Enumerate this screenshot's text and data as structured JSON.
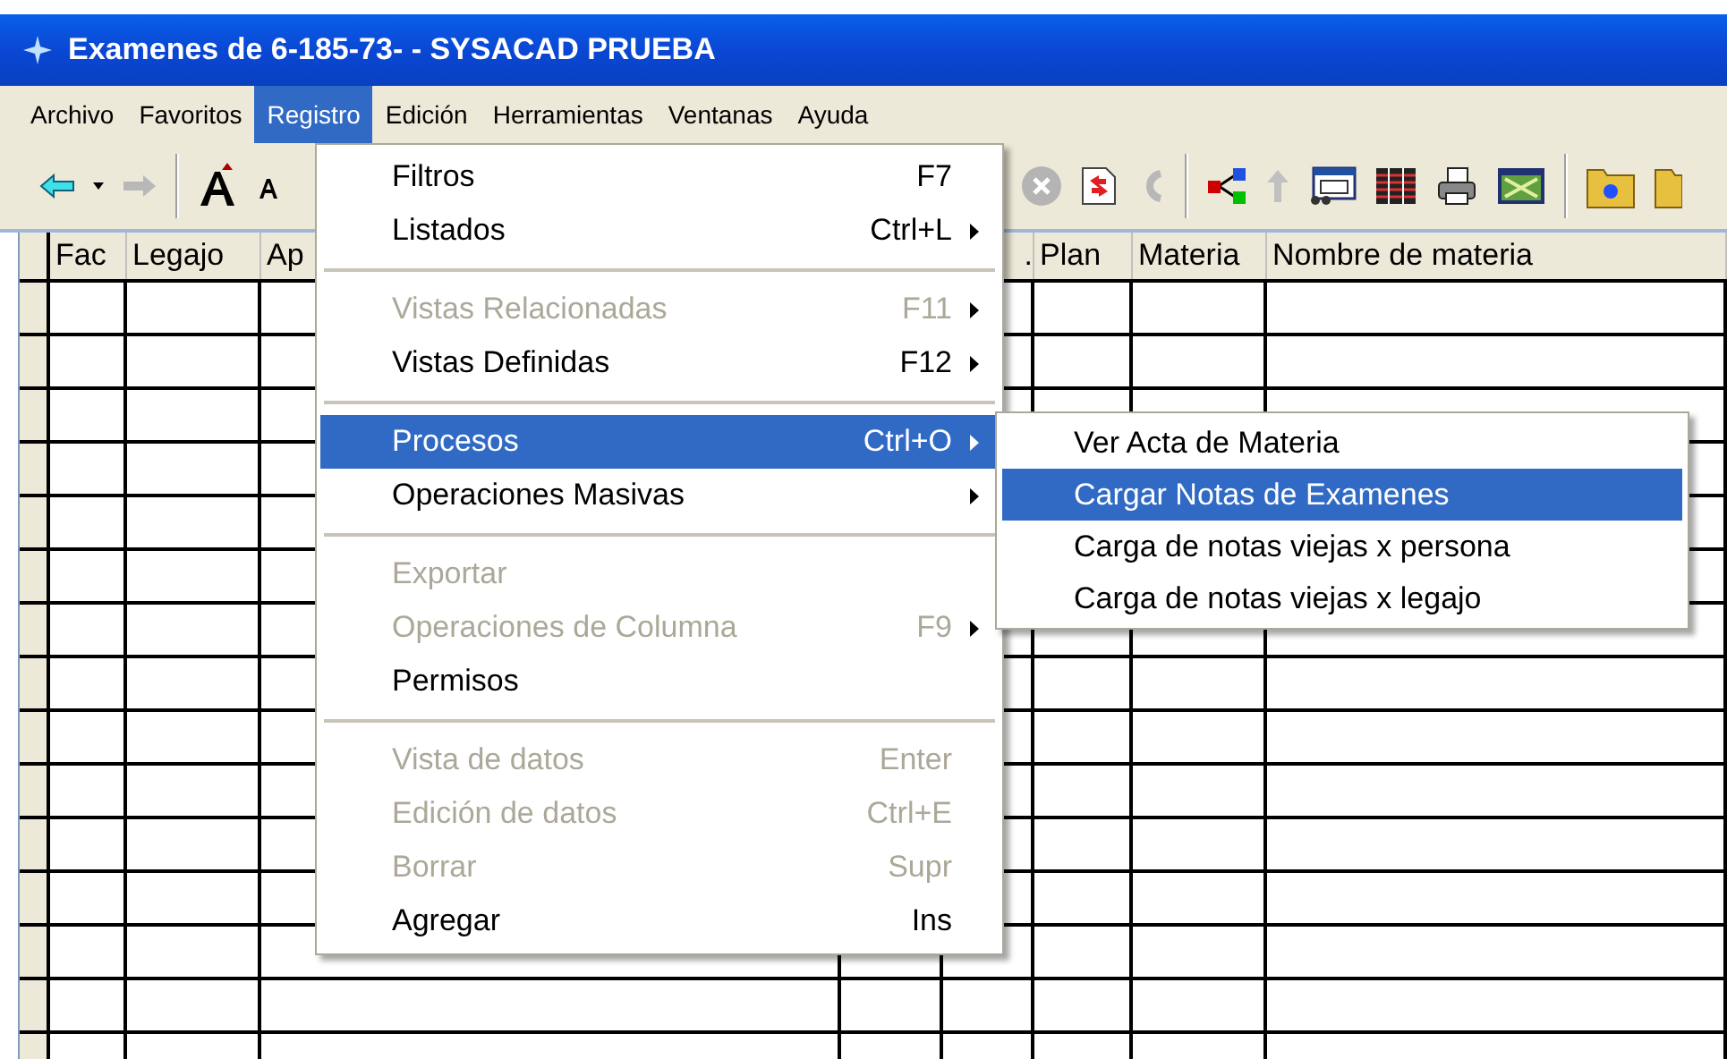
{
  "window": {
    "title": "Examenes de 6-185-73- - SYSACAD PRUEBA"
  },
  "menu_bar": [
    {
      "label": "Archivo",
      "selected": false
    },
    {
      "label": "Favoritos",
      "selected": false
    },
    {
      "label": "Registro",
      "selected": true
    },
    {
      "label": "Edición",
      "selected": false
    },
    {
      "label": "Herramientas",
      "selected": false
    },
    {
      "label": "Ventanas",
      "selected": false
    },
    {
      "label": "Ayuda",
      "selected": false
    }
  ],
  "grid": {
    "columns": [
      {
        "label": "Fac"
      },
      {
        "label": "Legajo"
      },
      {
        "label": "Ap"
      },
      {},
      {
        "label": "."
      },
      {
        "label": "Plan"
      },
      {
        "label": "Materia"
      },
      {
        "label": "Nombre de materia"
      }
    ]
  },
  "menu": {
    "items": [
      {
        "kind": "item",
        "label": "Filtros",
        "shortcut": "F7",
        "submenu": false,
        "disabled": false,
        "selected": false
      },
      {
        "kind": "item",
        "label": "Listados",
        "shortcut": "Ctrl+L",
        "submenu": true,
        "disabled": false,
        "selected": false
      },
      {
        "kind": "separator"
      },
      {
        "kind": "item",
        "label": "Vistas Relacionadas",
        "shortcut": "F11",
        "submenu": true,
        "disabled": true,
        "selected": false
      },
      {
        "kind": "item",
        "label": "Vistas Definidas",
        "shortcut": "F12",
        "submenu": true,
        "disabled": false,
        "selected": false
      },
      {
        "kind": "separator"
      },
      {
        "kind": "item",
        "label": "Procesos",
        "shortcut": "Ctrl+O",
        "submenu": true,
        "disabled": false,
        "selected": true
      },
      {
        "kind": "item",
        "label": "Operaciones Masivas",
        "submenu": true,
        "disabled": false,
        "selected": false
      },
      {
        "kind": "separator"
      },
      {
        "kind": "item",
        "label": "Exportar",
        "submenu": false,
        "disabled": true,
        "selected": false
      },
      {
        "kind": "item",
        "label": "Operaciones de Columna",
        "shortcut": "F9",
        "submenu": true,
        "disabled": true,
        "selected": false
      },
      {
        "kind": "item",
        "label": "Permisos",
        "submenu": false,
        "disabled": false,
        "selected": false
      },
      {
        "kind": "separator"
      },
      {
        "kind": "item",
        "label": "Vista de datos",
        "shortcut": "Enter",
        "submenu": false,
        "disabled": true,
        "selected": false
      },
      {
        "kind": "item",
        "label": "Edición de datos",
        "shortcut": "Ctrl+E",
        "submenu": false,
        "disabled": true,
        "selected": false
      },
      {
        "kind": "item",
        "label": "Borrar",
        "shortcut": "Supr",
        "submenu": false,
        "disabled": true,
        "selected": false
      },
      {
        "kind": "item",
        "label": "Agregar",
        "shortcut": "Ins",
        "submenu": false,
        "disabled": false,
        "selected": false
      }
    ]
  },
  "submenu": {
    "items": [
      {
        "label": "Ver Acta de Materia",
        "selected": false
      },
      {
        "label": "Cargar Notas de Examenes",
        "selected": true
      },
      {
        "label": "Carga de notas viejas x persona",
        "selected": false
      },
      {
        "label": "Carga de notas viejas x legajo",
        "selected": false
      }
    ]
  }
}
